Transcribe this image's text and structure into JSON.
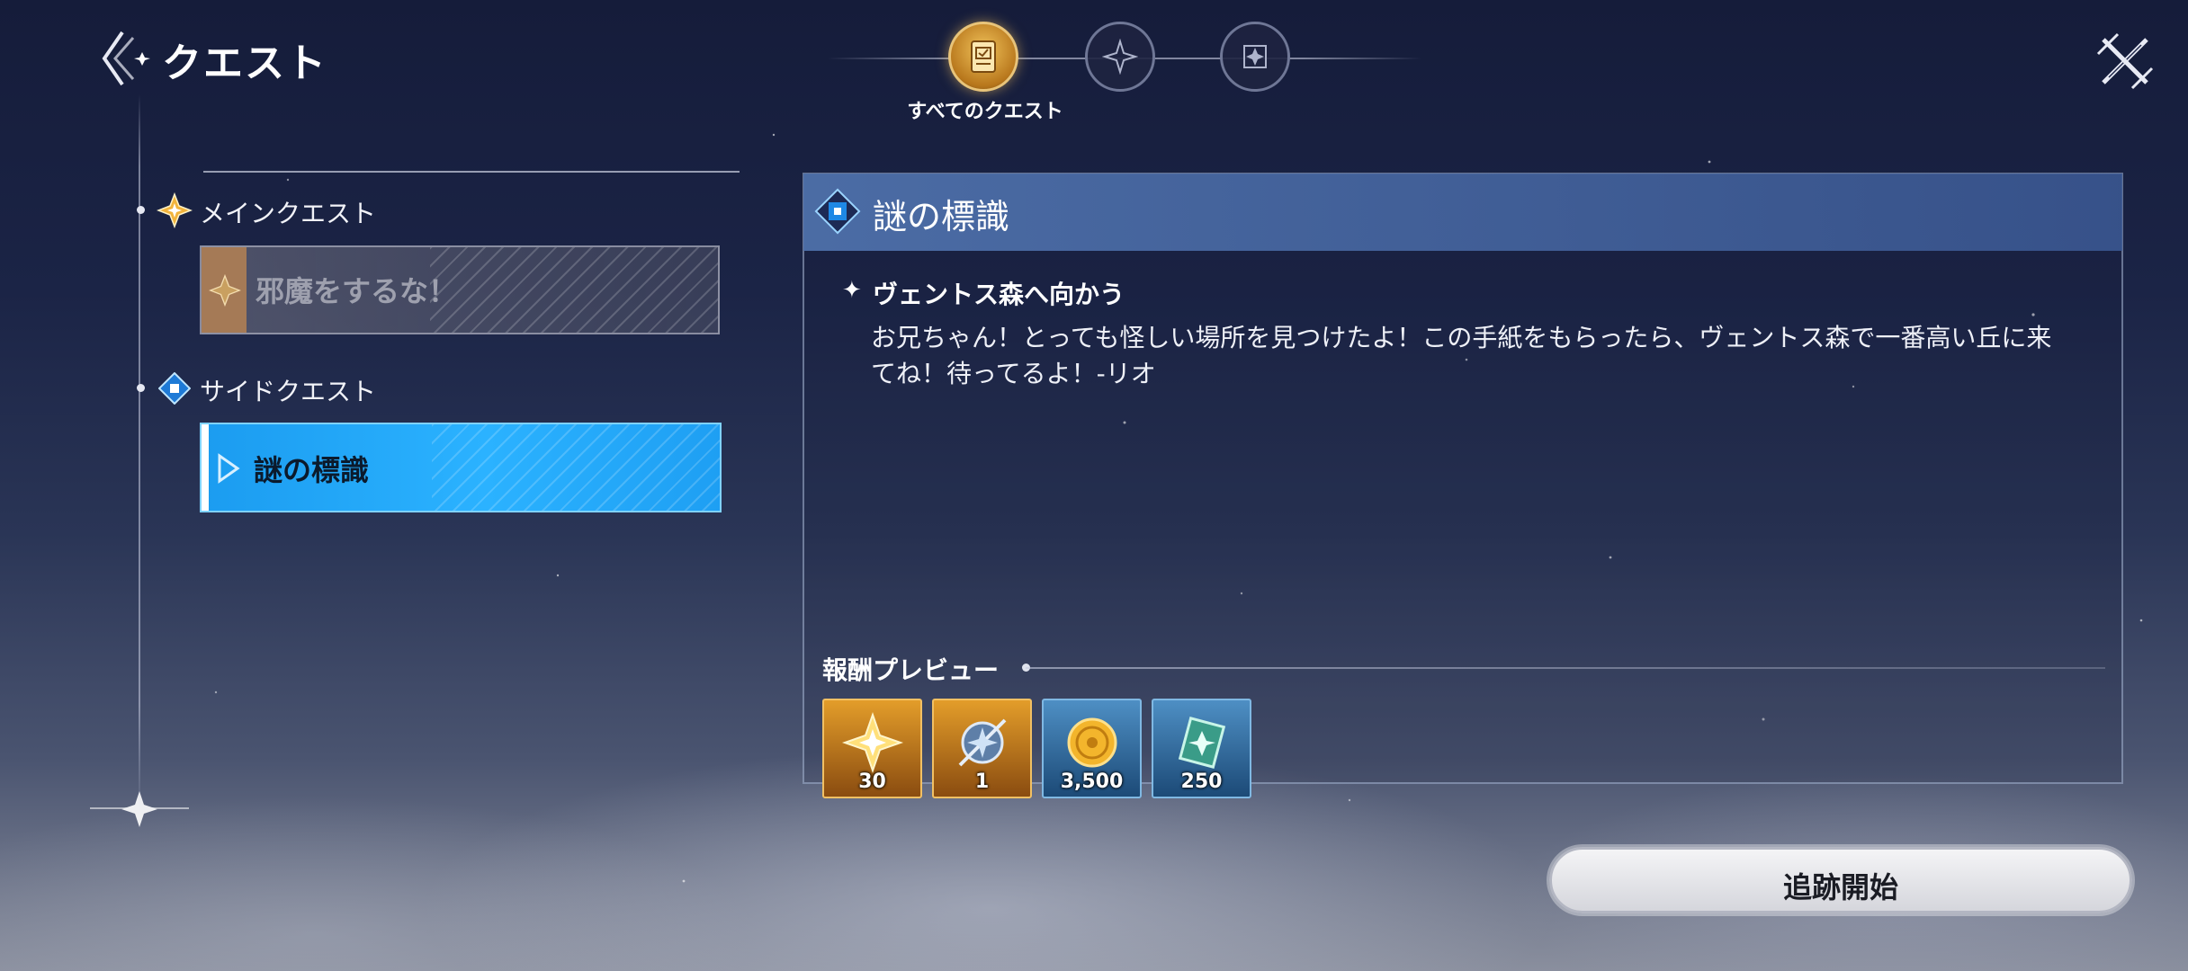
{
  "header": {
    "title": "クエスト",
    "back_icon": "back-chevron-icon",
    "nav_tabs": [
      {
        "label": "すべてのクエスト",
        "icon": "scroll-icon",
        "active": true
      },
      {
        "icon": "four-point-star-icon",
        "active": false
      },
      {
        "icon": "diamond-star-icon",
        "active": false
      }
    ],
    "corner_icon": "crossed-swords-icon"
  },
  "quest_list": {
    "categories": [
      {
        "label": "メインクエスト",
        "icon": "gold-star-icon",
        "items": [
          {
            "label": "邪魔をするな！",
            "selected": false
          }
        ]
      },
      {
        "label": "サイドクエスト",
        "icon": "blue-diamond-icon",
        "items": [
          {
            "label": "謎の標識",
            "selected": true
          }
        ]
      }
    ]
  },
  "detail": {
    "title": "謎の標識",
    "objective": {
      "title": "ヴェントス森へ向かう",
      "description": "お兄ちゃん！とっても怪しい場所を見つけたよ！この手紙をもらったら、ヴェントス森で一番高い丘に来てね！待ってるよ！-リオ"
    },
    "reward_label": "報酬プレビュー",
    "rewards": [
      {
        "icon": "gold-star-icon",
        "qty": "30",
        "rarity": "gold"
      },
      {
        "icon": "compass-gem-icon",
        "qty": "1",
        "rarity": "gold"
      },
      {
        "icon": "gold-coin-icon",
        "qty": "3,500",
        "rarity": "blue"
      },
      {
        "icon": "crystal-card-icon",
        "qty": "250",
        "rarity": "blue"
      }
    ]
  },
  "actions": {
    "track_label": "追跡開始"
  },
  "colors": {
    "selected": "#2bb2ff",
    "panel_header": "#4e70aa",
    "gold": "#e39d2a"
  }
}
